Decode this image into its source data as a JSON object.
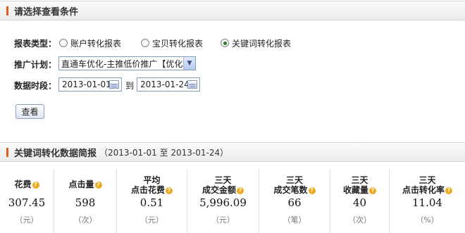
{
  "section1": {
    "title": "请选择查看条件"
  },
  "report_type": {
    "label": "报表类型：",
    "options": [
      "账户转化报表",
      "宝贝转化报表",
      "关键词转化报表"
    ],
    "selected": "关键词转化报表"
  },
  "plan": {
    "label": "推广计划：",
    "value": "直通车优化-主推低价推广【优化词】"
  },
  "period": {
    "label": "数据时段：",
    "start": "2013-01-01",
    "to": "到",
    "end": "2013-01-24"
  },
  "view_button": "查看",
  "section2": {
    "title": "关键词转化数据简报",
    "range": "（2013-01-01 至 2013-01-24）"
  },
  "stats": [
    {
      "line1": "",
      "line2": "花费",
      "value": "307.45",
      "unit": "（元）"
    },
    {
      "line1": "",
      "line2": "点击量",
      "value": "598",
      "unit": "（次）"
    },
    {
      "line1": "平均",
      "line2": "点击花费",
      "value": "0.51",
      "unit": "（元）"
    },
    {
      "line1": "三天",
      "line2": "成交金额",
      "value": "5,996.09",
      "unit": "（元）"
    },
    {
      "line1": "三天",
      "line2": "成交笔数",
      "value": "66",
      "unit": "（笔）"
    },
    {
      "line1": "三天",
      "line2": "收藏量",
      "value": "40",
      "unit": "（次）"
    },
    {
      "line1": "三天",
      "line2": "点击转化率",
      "value": "11.04",
      "unit": "（%）"
    }
  ]
}
